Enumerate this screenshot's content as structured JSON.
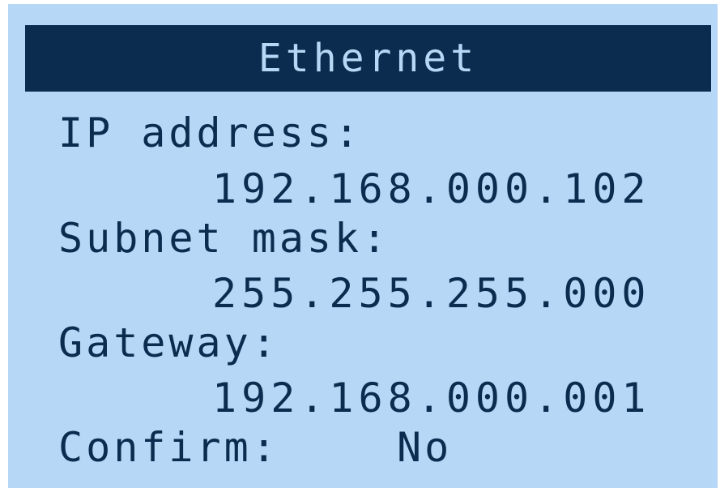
{
  "screen": {
    "title": "Ethernet",
    "fields": [
      {
        "label": "IP address:",
        "value": "192.168.000.102"
      },
      {
        "label": "Subnet mask:",
        "value": "255.255.255.000"
      },
      {
        "label": "Gateway:",
        "value": "192.168.000.001"
      }
    ],
    "confirm": {
      "label": "Confirm:",
      "value": "No"
    }
  },
  "colors": {
    "background": "#b7d7f6",
    "title_bar": "#0c2c4f",
    "text": "#0c2c4f"
  }
}
